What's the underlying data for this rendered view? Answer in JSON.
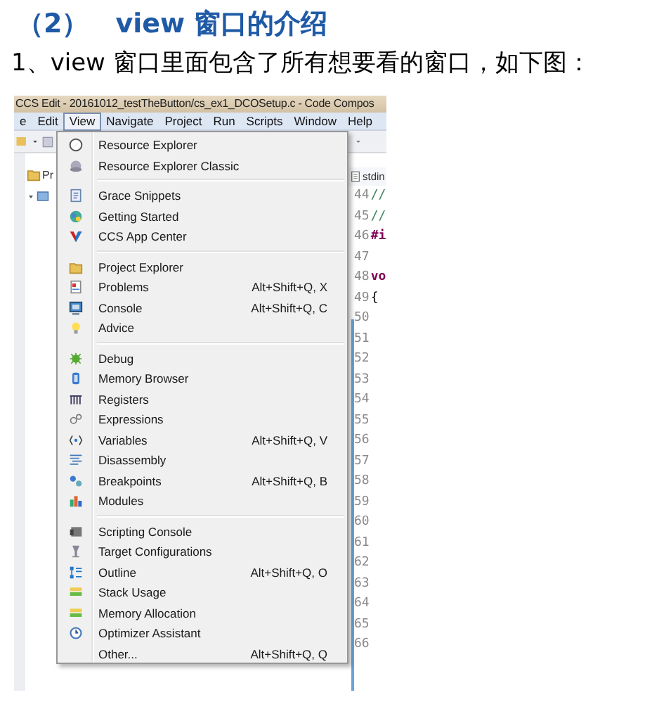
{
  "heading": "（2）　view 窗口的介绍",
  "paragraph": "1、view 窗口里面包含了所有想要看的窗口，如下图：",
  "screenshot": {
    "title": "CCS Edit - 20161012_testTheButton/cs_ex1_DCOSetup.c - Code Compos",
    "menubar": [
      {
        "label": "e",
        "selected": false
      },
      {
        "label": "Edit",
        "selected": false
      },
      {
        "label": "View",
        "selected": true
      },
      {
        "label": "Navigate",
        "selected": false
      },
      {
        "label": "Project",
        "selected": false
      },
      {
        "label": "Run",
        "selected": false
      },
      {
        "label": "Scripts",
        "selected": false
      },
      {
        "label": "Window",
        "selected": false
      },
      {
        "label": "Help",
        "selected": false
      }
    ],
    "side_panel": {
      "label": "Pr"
    },
    "editor": {
      "tab": "stdin",
      "lines": [
        {
          "number": "44",
          "code": "//",
          "kind": "comment"
        },
        {
          "number": "45",
          "code": "//",
          "kind": "comment"
        },
        {
          "number": "46",
          "code": "#i",
          "kind": "directive"
        },
        {
          "number": "47"
        },
        {
          "number": "48",
          "code": "vo",
          "kind": "keyword"
        },
        {
          "number": "49",
          "code": "{",
          "kind": "plain"
        },
        {
          "number": "50"
        },
        {
          "number": "51"
        },
        {
          "number": "52"
        },
        {
          "number": "53"
        },
        {
          "number": "54"
        },
        {
          "number": "55"
        },
        {
          "number": "56"
        },
        {
          "number": "57"
        },
        {
          "number": "58"
        },
        {
          "number": "59"
        },
        {
          "number": "60"
        },
        {
          "number": "61"
        },
        {
          "number": "62"
        },
        {
          "number": "63"
        },
        {
          "number": "64"
        },
        {
          "number": "65"
        },
        {
          "number": "66"
        }
      ]
    },
    "view_menu": {
      "groups": [
        [
          {
            "label": "Resource Explorer"
          },
          {
            "label": "Resource Explorer Classic"
          }
        ],
        [
          {
            "label": "Grace Snippets"
          },
          {
            "label": "Getting Started"
          },
          {
            "label": "CCS App Center"
          }
        ],
        [
          {
            "label": "Project Explorer"
          },
          {
            "label": "Problems",
            "shortcut": "Alt+Shift+Q, X"
          },
          {
            "label": "Console",
            "shortcut": "Alt+Shift+Q, C"
          },
          {
            "label": "Advice"
          }
        ],
        [
          {
            "label": "Debug"
          },
          {
            "label": "Memory Browser"
          },
          {
            "label": "Registers"
          },
          {
            "label": "Expressions"
          },
          {
            "label": "Variables",
            "shortcut": "Alt+Shift+Q, V"
          },
          {
            "label": "Disassembly"
          },
          {
            "label": "Breakpoints",
            "shortcut": "Alt+Shift+Q, B"
          },
          {
            "label": "Modules"
          }
        ],
        [
          {
            "label": "Scripting Console"
          },
          {
            "label": "Target Configurations"
          },
          {
            "label": "Outline",
            "shortcut": "Alt+Shift+Q, O"
          },
          {
            "label": "Stack Usage"
          },
          {
            "label": "Memory Allocation"
          },
          {
            "label": "Optimizer Assistant"
          },
          {
            "label": "Other...",
            "shortcut": "Alt+Shift+Q, Q"
          }
        ]
      ]
    }
  }
}
